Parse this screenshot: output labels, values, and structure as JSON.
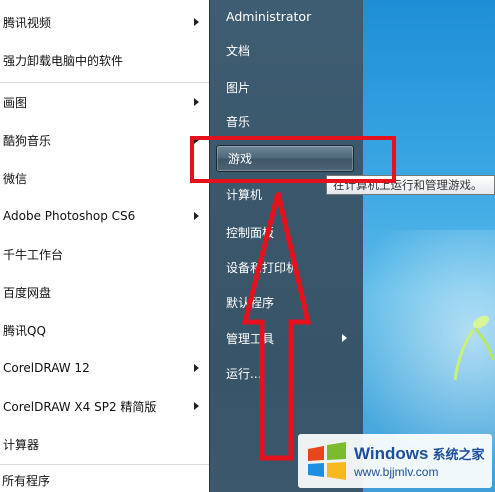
{
  "left_menu": {
    "items": [
      {
        "label": "腾讯视频",
        "has_submenu": true
      },
      {
        "label": "强力卸载电脑中的软件",
        "has_submenu": false
      },
      {
        "label": "画图",
        "has_submenu": true
      },
      {
        "label": "酷狗音乐",
        "has_submenu": true
      },
      {
        "label": "微信",
        "has_submenu": false
      },
      {
        "label": "Adobe Photoshop CS6",
        "has_submenu": true
      },
      {
        "label": "千牛工作台",
        "has_submenu": false
      },
      {
        "label": "百度网盘",
        "has_submenu": false
      },
      {
        "label": "腾讯QQ",
        "has_submenu": false
      },
      {
        "label": "CorelDRAW 12",
        "has_submenu": true
      },
      {
        "label": "CorelDRAW X4 SP2 精简版",
        "has_submenu": true
      },
      {
        "label": "计算器",
        "has_submenu": false
      }
    ],
    "all_programs_label": "所有程序"
  },
  "right_menu": {
    "user_label": "Administrator",
    "items": {
      "documents": "文档",
      "pictures": "图片",
      "music": "音乐",
      "games": "游戏",
      "computer": "计算机",
      "control_panel": "控制面板",
      "devices_printers": "设备和打印机",
      "default_programs": "默认程序",
      "admin_tools": "管理工具",
      "run": "运行..."
    }
  },
  "tooltip": {
    "text": "在计算机上运行和管理游戏。"
  },
  "annotation": {
    "color": "#e5121d"
  },
  "watermark": {
    "brand": "Windows",
    "cn_name": "系统之家",
    "url": "www.bjjmlv.com"
  },
  "colors": {
    "start_menu_right": "#3f5d72",
    "desktop_blue": "#3aa6e3",
    "watermark_blue": "#1e4f9c"
  }
}
